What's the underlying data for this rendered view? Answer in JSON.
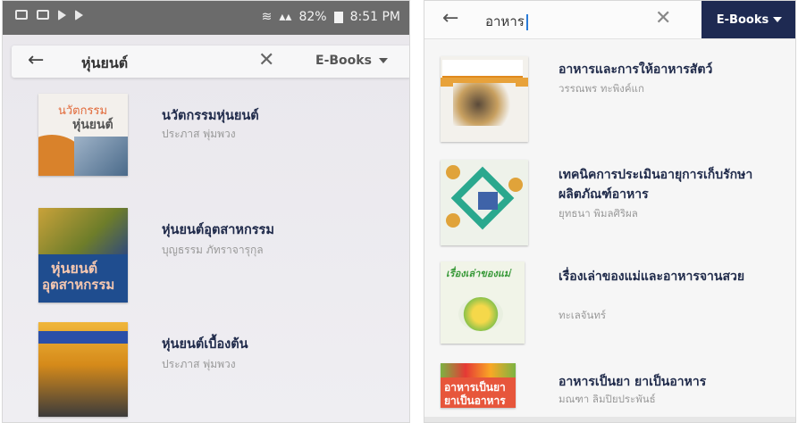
{
  "left": {
    "status": {
      "battery": "82%",
      "time": "8:51 PM"
    },
    "search": {
      "query": "หุ่นยนต์",
      "filter": "E-Books"
    },
    "books": [
      {
        "title": "นวัตกรรมหุ่นยนต์",
        "author": "ประภาส พุ่มพวง",
        "cover_line1": "นวัตกรรม",
        "cover_line2": "หุ่นยนต์"
      },
      {
        "title": "หุ่นยนต์อุตสาหกรรม",
        "author": "บุญธรรม ภัทราจารุกุล",
        "cover_line1": "หุ่นยนต์",
        "cover_line2": "อุตสาหกรรม"
      },
      {
        "title": "หุ่นยนต์เบื้องต้น",
        "author": "ประภาส พุ่มพวง"
      }
    ]
  },
  "right": {
    "search": {
      "query": "อาหาร",
      "filter": "E-Books"
    },
    "books": [
      {
        "title": "อาหารและการให้อาหารสัตว์",
        "author": "วรรณพร ทะพิงค์แก"
      },
      {
        "title": "เทคนิคการประเมินอายุการเก็บรักษาผลิตภัณฑ์อาหาร",
        "author": "ยุทธนา พิมลศิริผล"
      },
      {
        "title": "เรื่องเล่าของแม่และอาหารจานสวย",
        "author": "ทะเลจันทร์",
        "cover_text": "เรื่องเล่าของแม่"
      },
      {
        "title": "อาหารเป็นยา ยาเป็นอาหาร",
        "author": "มณฑา ลิมปิยประพันธ์",
        "cover_line1": "อาหารเป็นยา",
        "cover_line2": "ยาเป็นอาหาร"
      }
    ]
  },
  "icons": [
    "back-arrow-icon",
    "clear-icon",
    "dropdown-triangle-icon",
    "battery-icon",
    "signal-icon",
    "wifi-icon"
  ]
}
